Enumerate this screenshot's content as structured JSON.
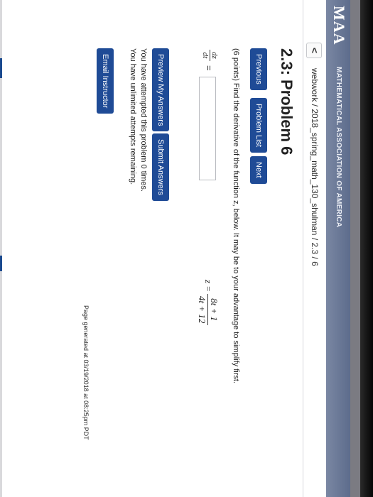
{
  "header": {
    "logo": "MAA",
    "logo_subtitle": "MATHEMATICAL ASSOCIATION OF AMERICA"
  },
  "nav": {
    "back_symbol": "<",
    "breadcrumb": "webwork / 2018_spring_math_130_shulman / 2.3 / 6"
  },
  "problem": {
    "title": "2.3: Problem 6",
    "buttons": {
      "previous": "Previous",
      "problem_list": "Problem List",
      "next": "Next"
    },
    "prompt": "(6 points) Find the derivative of the function z, below. It may be to your advantage to simplify first.",
    "derivative_label": {
      "numerator": "dz",
      "denominator": "dt"
    },
    "equals": "=",
    "answer_value": "",
    "function_label": "z =",
    "function": {
      "numerator": "8t + 1",
      "denominator": "4t + 12"
    }
  },
  "actions": {
    "preview": "Preview My Answers",
    "submit": "Submit Answers",
    "attempted": "You have attempted this problem 0 times.",
    "remaining": "You have unlimited attempts remaining.",
    "email": "Email Instructor"
  },
  "footer": {
    "generated": "Page generated at 03/19/2018 at 08:25pm PDT"
  },
  "colors": {
    "button": "#1f4b96",
    "banner": "#6b7895"
  }
}
